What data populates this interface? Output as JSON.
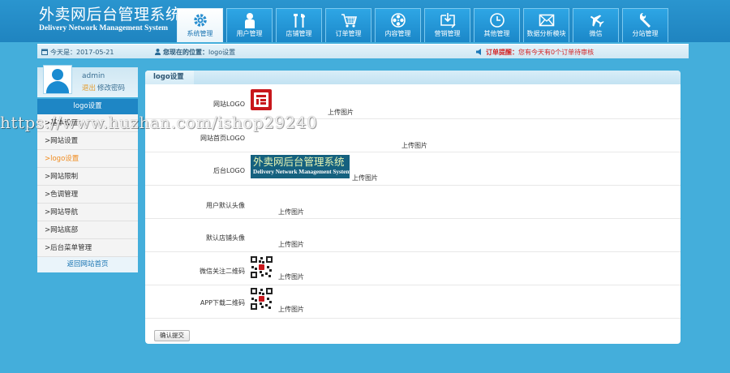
{
  "header": {
    "title_cn": "外卖网后台管理系统",
    "title_en": "Delivery Network Management System"
  },
  "nav": [
    {
      "label": "系统管理",
      "icon": "gear-icon",
      "active": true
    },
    {
      "label": "用户管理",
      "icon": "user-icon"
    },
    {
      "label": "店铺管理",
      "icon": "tools-icon"
    },
    {
      "label": "订单管理",
      "icon": "cart-icon"
    },
    {
      "label": "内容管理",
      "icon": "film-reel-icon"
    },
    {
      "label": "营销管理",
      "icon": "download-box-icon"
    },
    {
      "label": "其他管理",
      "icon": "clock-icon"
    },
    {
      "label": "数据分析模块",
      "icon": "envelope-icon"
    },
    {
      "label": "微信",
      "icon": "airplane-icon"
    },
    {
      "label": "分站管理",
      "icon": "wrench-icon"
    }
  ],
  "infobar": {
    "date_label": "今天是：2017-05-21",
    "location_prefix": "您现在的位置：",
    "location_value": "logo设置",
    "notice_prefix": "订单提醒：",
    "notice_text": "您有今天有0个订单待审核"
  },
  "sidebar": {
    "username": "admin",
    "logout": "退出",
    "change_password": "修改密码",
    "section_title": "logo设置",
    "items": [
      {
        "label": ">基本设置"
      },
      {
        "label": ">网站设置"
      },
      {
        "label": ">logo设置",
        "active": true
      },
      {
        "label": ">网站限制"
      },
      {
        "label": ">色调管理"
      },
      {
        "label": ">网站导航"
      },
      {
        "label": ">网站底部"
      },
      {
        "label": ">后台菜单管理"
      }
    ],
    "back_link": "返回网站首页"
  },
  "panel": {
    "title": "logo设置",
    "rows": [
      {
        "label": "网站LOGO",
        "button": "上传图片"
      },
      {
        "label": "网站首页LOGO",
        "button": "上传图片"
      },
      {
        "label": "后台LOGO",
        "button": "上传图片",
        "image_text_cn": "外卖网后台管理系统",
        "image_text_en": "Delivery Network Management System"
      },
      {
        "label": "用户默认头像",
        "button": "上传图片"
      },
      {
        "label": "默认店铺头像",
        "button": "上传图片"
      },
      {
        "label": "微信关注二维码",
        "button": "上传图片"
      },
      {
        "label": "APP下载二维码",
        "button": "上传图片"
      }
    ],
    "submit": "确认提交"
  },
  "watermark": "https://www.huzhan.com/ishop29240"
}
